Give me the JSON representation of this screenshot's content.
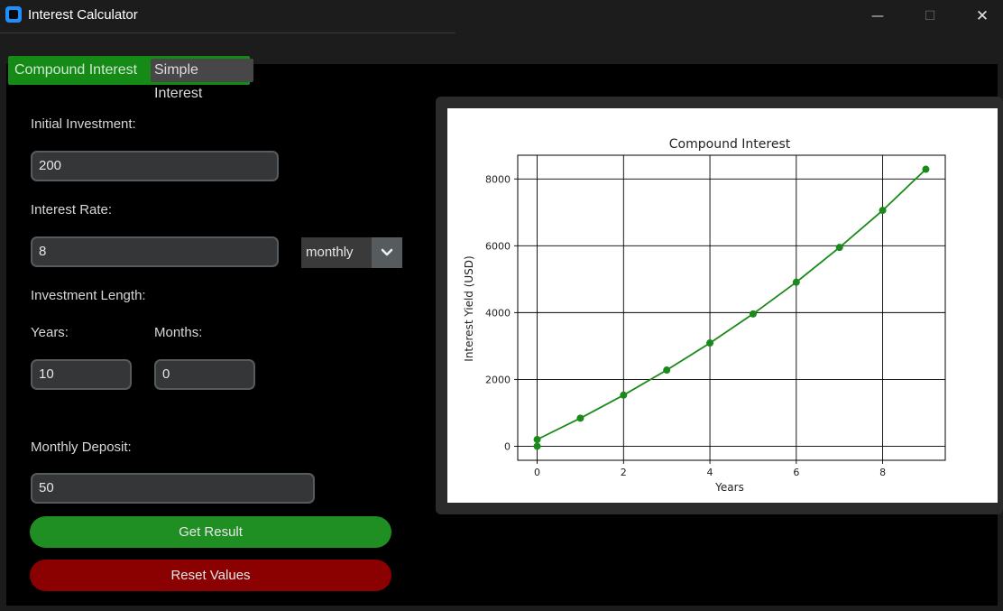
{
  "window": {
    "title": "Interest Calculator",
    "min_glyph": "—",
    "max_glyph": "☐",
    "close_glyph": "✕"
  },
  "tabs": [
    {
      "label": "Compound Interest",
      "active": true
    },
    {
      "label": "Simple Interest",
      "active": false
    }
  ],
  "form": {
    "initial_investment_label": "Initial Investment:",
    "initial_investment_value": "200",
    "interest_rate_label": "Interest Rate:",
    "interest_rate_value": "8",
    "rate_period": "monthly",
    "investment_length_label": "Investment Length:",
    "years_label": "Years:",
    "years_value": "10",
    "months_label": "Months:",
    "months_value": "0",
    "monthly_deposit_label": "Monthly Deposit:",
    "monthly_deposit_value": "50",
    "get_result_label": "Get Result",
    "reset_label": "Reset Values"
  },
  "colors": {
    "accent_green": "#1f8f23",
    "reset_red": "#8b0000",
    "series_color": "#1a8a1a"
  },
  "chart_data": {
    "type": "line",
    "title": "Compound Interest",
    "xlabel": "Years",
    "ylabel": "Interest Yield (USD)",
    "x": [
      0,
      0,
      1,
      2,
      3,
      4,
      5,
      6,
      7,
      8,
      9
    ],
    "y": [
      0,
      200,
      840,
      1530,
      2280,
      3090,
      3960,
      4910,
      5950,
      7060,
      8290
    ],
    "xlim": [
      -0.45,
      9.45
    ],
    "ylim": [
      -420,
      8710
    ],
    "xticks": [
      0,
      2,
      4,
      6,
      8
    ],
    "yticks": [
      0,
      2000,
      4000,
      6000,
      8000
    ],
    "grid": true,
    "markers": true
  }
}
